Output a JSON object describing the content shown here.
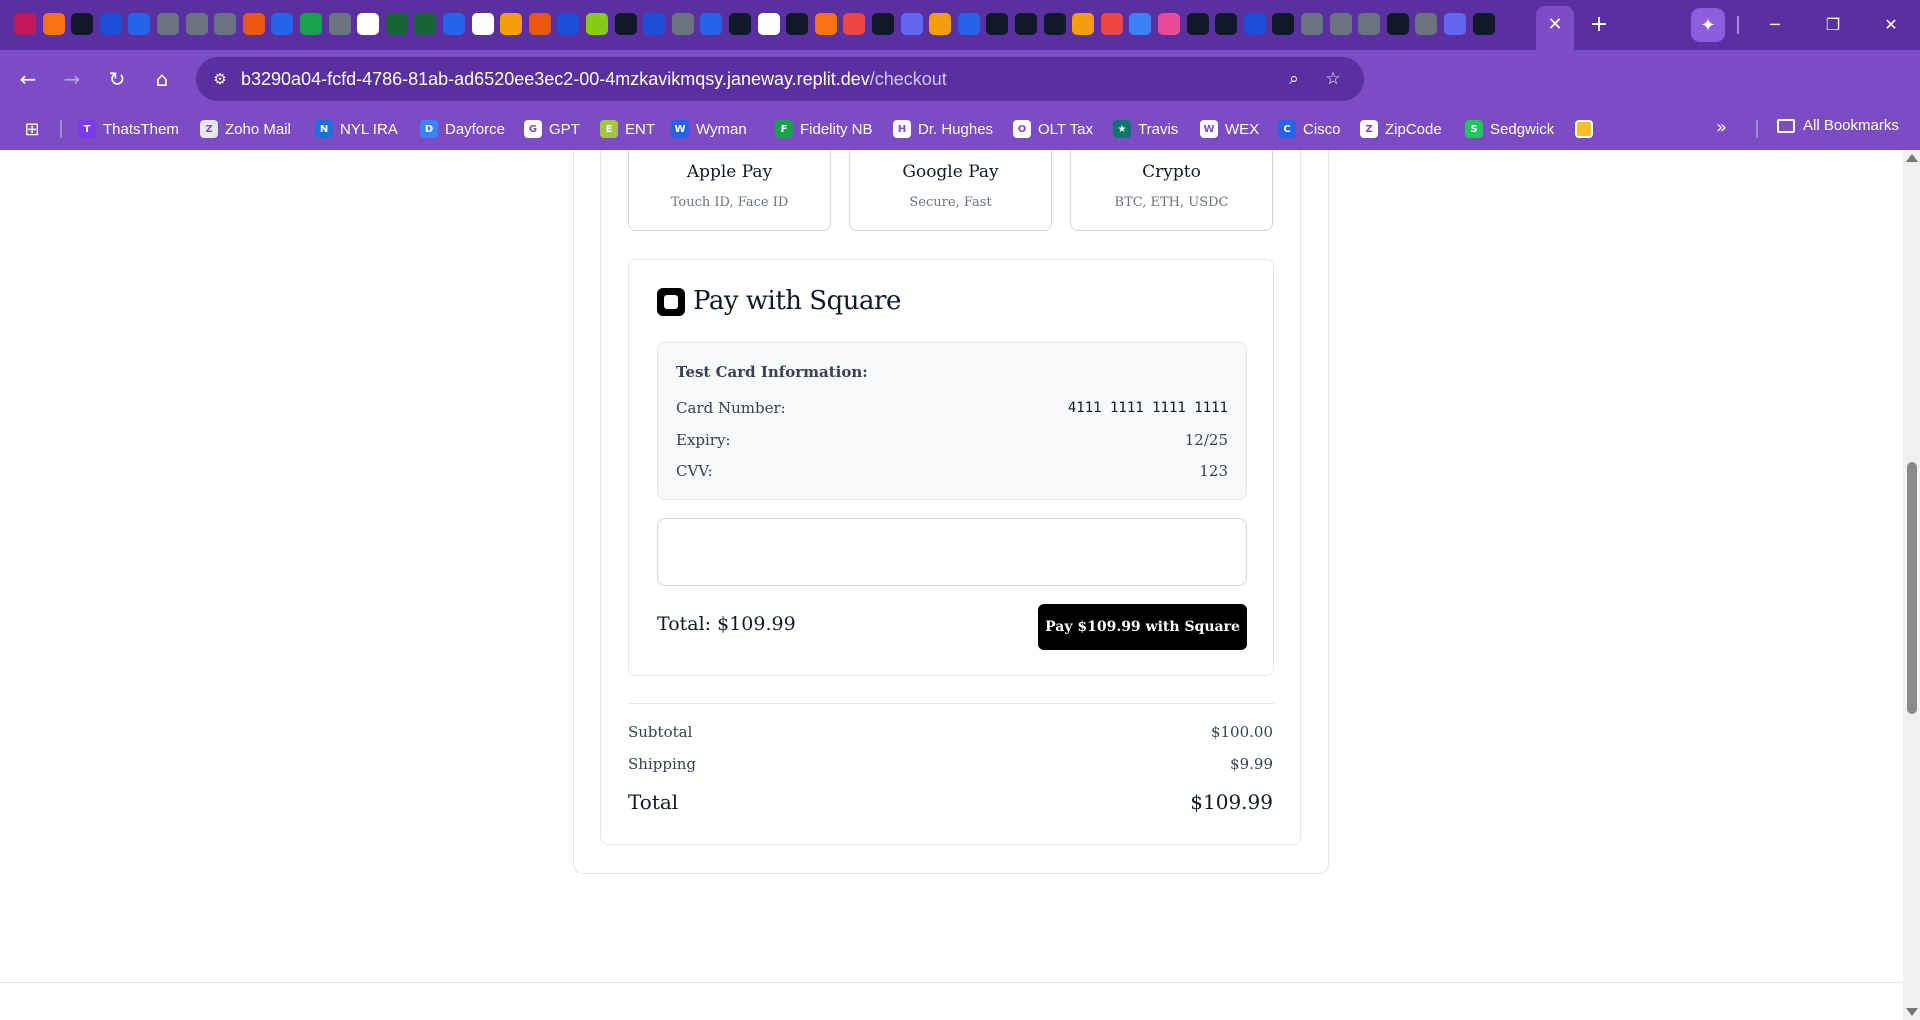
{
  "browser": {
    "address": {
      "host": "b3290a04-fcfd-4786-81ab-ad6520ee3ec2-00-4mzkavikmqsy.janeway.replit.dev",
      "path": "/checkout"
    },
    "bookmarks": [
      {
        "label": "ThatsThem",
        "icon": "T",
        "color": "#7c3aed"
      },
      {
        "label": "Zoho Mail",
        "icon": "Z",
        "color": "#e5e7eb"
      },
      {
        "label": "NYL IRA",
        "icon": "N",
        "color": "#1e6fd9"
      },
      {
        "label": "Dayforce",
        "icon": "D",
        "color": "#3b82f6"
      },
      {
        "label": "GPT",
        "icon": "G",
        "color": "#ffffff"
      },
      {
        "label": "ENT",
        "icon": "E",
        "color": "#a3c644"
      },
      {
        "label": "Wyman",
        "icon": "W",
        "color": "#2563eb"
      },
      {
        "label": "Fidelity NB",
        "icon": "F",
        "color": "#16a34a"
      },
      {
        "label": "Dr. Hughes",
        "icon": "H",
        "color": "#ffffff"
      },
      {
        "label": "OLT Tax",
        "icon": "O",
        "color": "#ffffff"
      },
      {
        "label": "Travis",
        "icon": "★",
        "color": "#0f766e"
      },
      {
        "label": "WEX",
        "icon": "W",
        "color": "#ffffff"
      },
      {
        "label": "Cisco",
        "icon": "C",
        "color": "#2563eb"
      },
      {
        "label": "ZipCode",
        "icon": "Z",
        "color": "#ffffff"
      },
      {
        "label": "Sedgwick",
        "icon": "S",
        "color": "#22c55e"
      }
    ],
    "all_bookmarks": "All Bookmarks",
    "tab_close_glyph": "✕",
    "new_tab_glyph": "+"
  },
  "payment_methods": [
    {
      "name": "Apple Pay",
      "sub": "Touch ID, Face ID"
    },
    {
      "name": "Google Pay",
      "sub": "Secure, Fast"
    },
    {
      "name": "Crypto",
      "sub": "BTC, ETH, USDC"
    }
  ],
  "square": {
    "title": "Pay with Square",
    "test_card": {
      "heading": "Test Card Information:",
      "card_number_label": "Card Number:",
      "card_number": "4111 1111 1111 1111",
      "expiry_label": "Expiry:",
      "expiry": "12/25",
      "cvv_label": "CVV:",
      "cvv": "123"
    },
    "total_text": "Total: $109.99",
    "pay_button": "Pay $109.99 with Square"
  },
  "summary": {
    "subtotal_label": "Subtotal",
    "subtotal": "$100.00",
    "shipping_label": "Shipping",
    "shipping": "$9.99",
    "total_label": "Total",
    "total": "$109.99"
  },
  "colors": {
    "chrome_dark": "#5a2fa0",
    "chrome": "#7b4cc4",
    "button_black": "#000000"
  }
}
